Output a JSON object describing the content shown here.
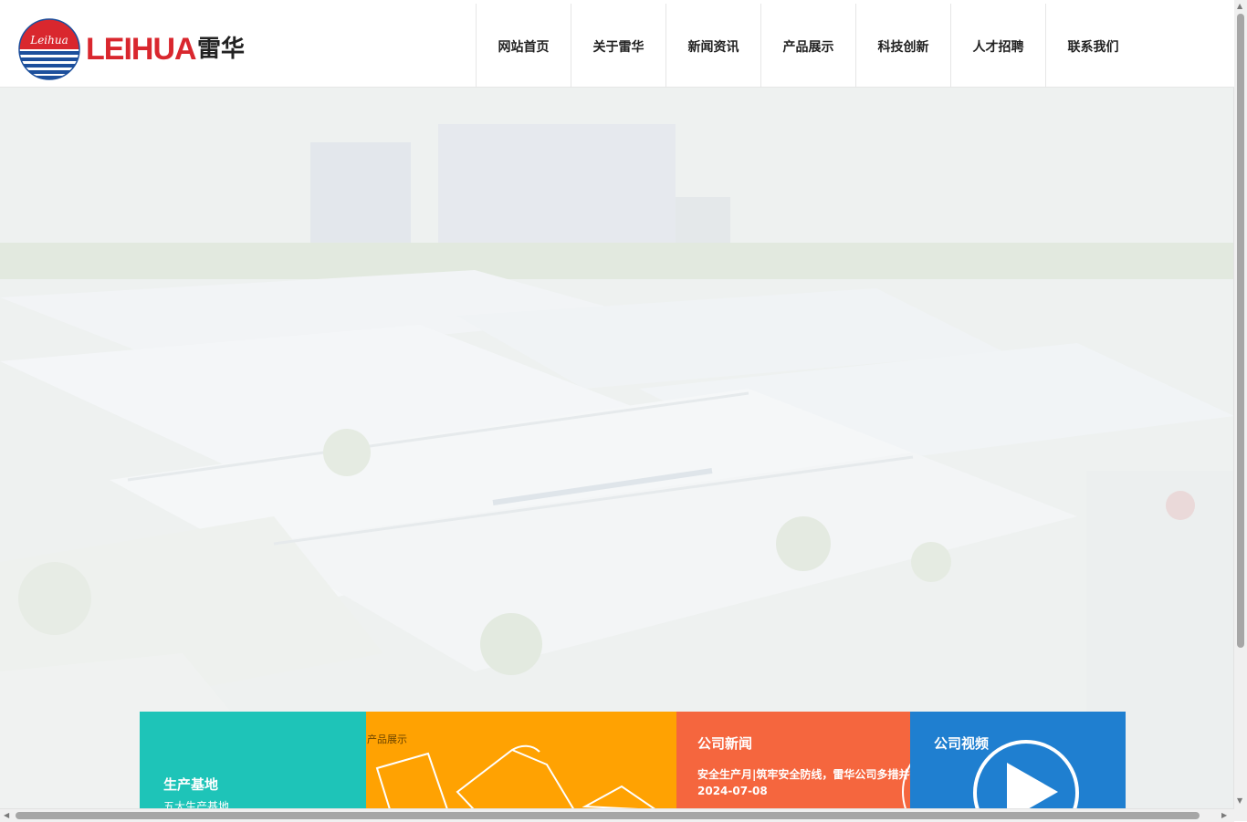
{
  "brand": {
    "logo_script": "Leihua",
    "name_latin": "LEIHUA",
    "name_cn": "雷华",
    "colors": {
      "red": "#d9272e",
      "blue": "#1c4f9c"
    }
  },
  "nav": {
    "items": [
      {
        "label": "网站首页"
      },
      {
        "label": "关于雷华"
      },
      {
        "label": "新闻资讯"
      },
      {
        "label": "产品展示"
      },
      {
        "label": "科技创新"
      },
      {
        "label": "人才招聘"
      },
      {
        "label": "联系我们"
      }
    ]
  },
  "cards": {
    "base": {
      "title": "生产基地",
      "subtitle": "五大生产基地",
      "color": "#1ec4b8"
    },
    "product": {
      "label": "产品展示",
      "color": "#ffa202"
    },
    "news": {
      "title": "公司新闻",
      "headline": "安全生产月|筑牢安全防线，雷华公司多措并举",
      "date": "2024-07-08",
      "color": "#f5663e"
    },
    "video": {
      "title": "公司视频",
      "icon": "play-icon",
      "color": "#1f7fd0"
    }
  }
}
